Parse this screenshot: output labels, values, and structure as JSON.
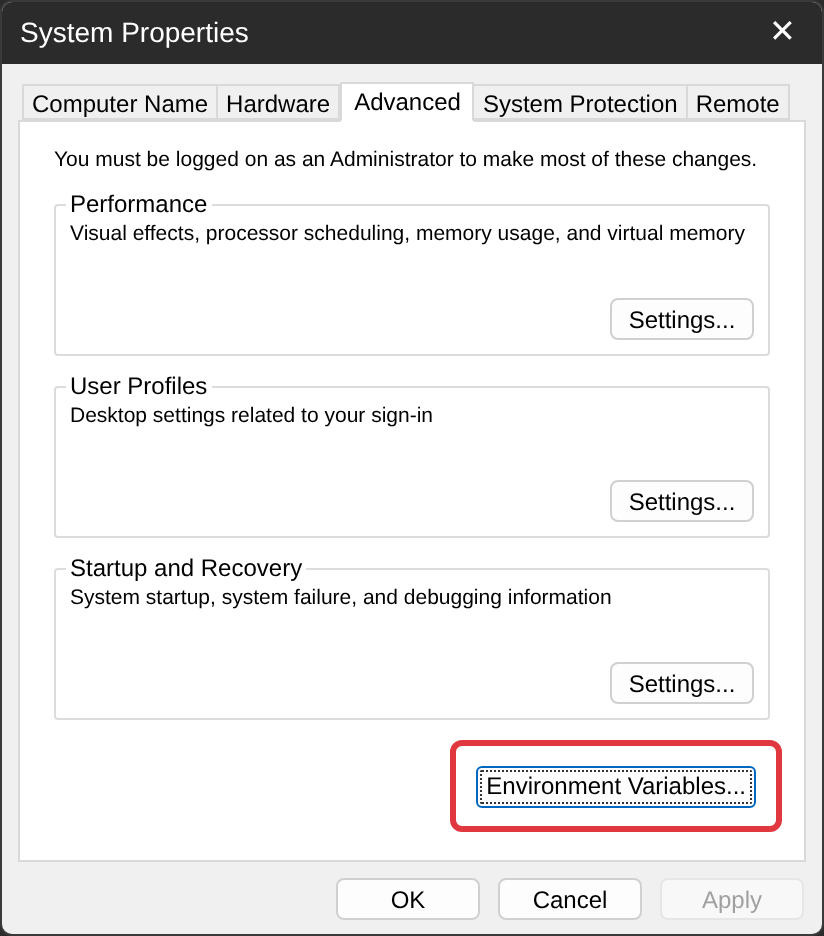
{
  "window": {
    "title": "System Properties",
    "close": "✕"
  },
  "tabs": [
    {
      "label": "Computer Name",
      "selected": false
    },
    {
      "label": "Hardware",
      "selected": false
    },
    {
      "label": "Advanced",
      "selected": true
    },
    {
      "label": "System Protection",
      "selected": false
    },
    {
      "label": "Remote",
      "selected": false
    }
  ],
  "notice": "You must be logged on as an Administrator to make most of these changes.",
  "groups": [
    {
      "title": "Performance",
      "description": "Visual effects, processor scheduling, memory usage, and virtual memory",
      "button": "Settings..."
    },
    {
      "title": "User Profiles",
      "description": "Desktop settings related to your sign-in",
      "button": "Settings..."
    },
    {
      "title": "Startup and Recovery",
      "description": "System startup, system failure, and debugging information",
      "button": "Settings..."
    }
  ],
  "environment_button": {
    "label": "Environment Variables...",
    "highlighted": true,
    "focused": true
  },
  "buttons": [
    {
      "label": "OK",
      "disabled": false
    },
    {
      "label": "Cancel",
      "disabled": false
    },
    {
      "label": "Apply",
      "disabled": true
    }
  ]
}
